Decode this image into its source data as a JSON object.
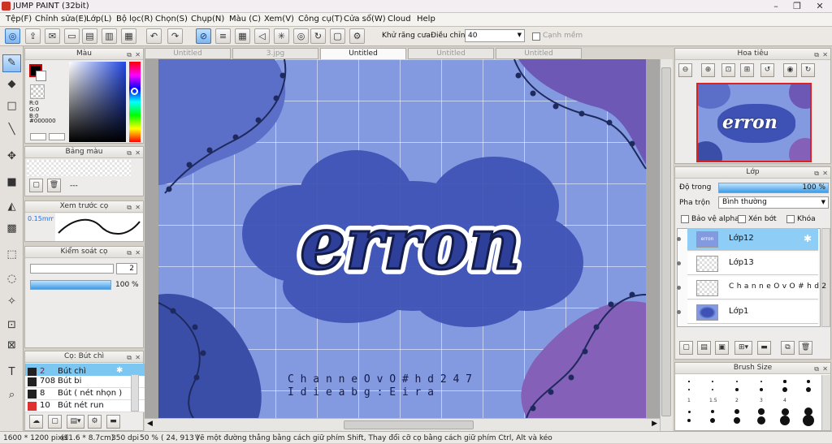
{
  "app": {
    "title": "JUMP PAINT (32bit)",
    "min": "–",
    "max": "❐",
    "close": "✕"
  },
  "menu": [
    "Tệp(F)",
    "Chỉnh sửa(E)",
    "Lớp(L)",
    "Bộ lọc(R)",
    "Chọn(S)",
    "Chụp(N)",
    "Màu (C)",
    "Xem(V)",
    "Công cụ(T)",
    "Cửa sổ(W)",
    "Cloud",
    "Help"
  ],
  "toolbar": {
    "antialias_label": "Khử răng cưa",
    "adjust_label": "Điều chỉnh",
    "adjust_value": "40",
    "snap_label": "Cạnh mềm"
  },
  "tabs": [
    "Untitled",
    "3.jpg",
    "Untitled",
    "Untitled",
    "Untitled"
  ],
  "color_panel": {
    "title": "Màu",
    "r": "R:0",
    "g": "G:0",
    "b": "B:0",
    "hex": "#000000"
  },
  "palette_panel": {
    "title": "Bảng màu",
    "dash": "---"
  },
  "brush_preview": {
    "title": "Xem trước cọ",
    "size": "0.15mm"
  },
  "brush_control": {
    "title": "Kiểm soát cọ",
    "size_value": "2",
    "opacity_value": "100 %",
    "opacity": 1.0
  },
  "brush_list": {
    "title": "Cọ: Bút chì",
    "items": [
      {
        "num": "2",
        "label": "Bút chì",
        "color": "#222222",
        "selected": true
      },
      {
        "num": "708",
        "label": "Bút bi",
        "color": "#222222",
        "selected": false
      },
      {
        "num": "8",
        "label": "Bút ( nét nhọn )",
        "color": "#222222",
        "selected": false
      },
      {
        "num": "10",
        "label": "Bút nét run",
        "color": "#e03030",
        "selected": false
      }
    ]
  },
  "navigator": {
    "title": "Hoa tiêu",
    "preview_text": "erron"
  },
  "layers": {
    "title": "Lớp",
    "opacity_label": "Độ trong",
    "opacity_value": "100 %",
    "opacity": 1.0,
    "blend_label": "Pha trộn",
    "blend_value": "Bình thường",
    "protect_alpha": "Bảo vệ alpha",
    "clip": "Xén bớt",
    "lock": "Khóa",
    "items": [
      {
        "name": "Lớp12",
        "selected": true
      },
      {
        "name": "Lớp13",
        "selected": false
      },
      {
        "name": "C h a n n e O v O # h d 2",
        "selected": false
      },
      {
        "name": "Lớp1",
        "selected": false
      }
    ]
  },
  "brush_size": {
    "title": "Brush Size",
    "labels": [
      "1",
      "1.5",
      "2",
      "3",
      "4"
    ]
  },
  "canvas": {
    "title_text": "erron",
    "credit1": "C h a n n e O v O # h d 2 4 7",
    "credit2": "I d i e a b g : E i r a"
  },
  "status": {
    "size": "1600 * 1200 pixel",
    "cm": "(11.6 * 8.7cm)",
    "dpi": "350 dpi",
    "zoom": "50 %",
    "coords": "( 24, 913 )",
    "hint": "Vẽ một đường thẳng bằng cách giữ phím Shift, Thay đổi cỡ cọ bằng cách giữ phím Ctrl, Alt và kéo"
  }
}
